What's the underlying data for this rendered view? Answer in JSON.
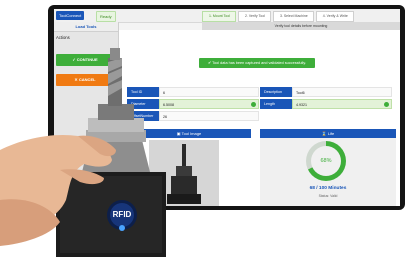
{
  "app": {
    "brand": "ToolConnect",
    "status": "Ready"
  },
  "steps": [
    "1. Mount Tool",
    "2. Verify Tool",
    "3. Select Machine",
    "4. Verify & Write"
  ],
  "subtitle": "Verify tool details before mounting",
  "sidebar": {
    "load_tools": "Load Tools",
    "actions": "Actions",
    "continue": "CONTINUE",
    "cancel": "CANCEL"
  },
  "success_message": "Tool data has been captured and validated successfully.",
  "fields": {
    "tool_id": {
      "label": "Tool ID",
      "value": "6"
    },
    "description": {
      "label": "Description",
      "value": "Tool6"
    },
    "diameter": {
      "label": "Diameter",
      "value": "6.5008"
    },
    "length": {
      "label": "Length",
      "value": "4.9321"
    },
    "offset_number": {
      "label": "OffsetNumber",
      "value": "26"
    }
  },
  "panels": {
    "tool_image": "Tool Image",
    "life": "Life"
  },
  "life": {
    "percent": "68%",
    "percent_value": 68,
    "count": "68 / 100 Minutes",
    "status": "Status: Valid"
  },
  "badge": "RFID",
  "colors": {
    "primary": "#1a56b8",
    "success": "#3eae3a",
    "warning": "#f07a12"
  }
}
